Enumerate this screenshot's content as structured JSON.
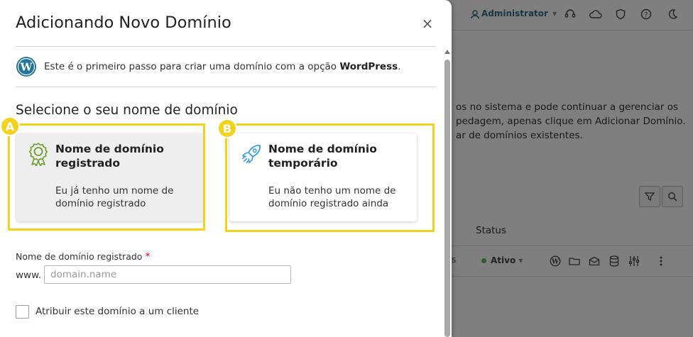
{
  "background": {
    "topbar": {
      "user_label": "Administrator",
      "chevron": "▾",
      "icons": [
        "support-icon",
        "cloud-icon",
        "shield-icon",
        "help-icon",
        "moon-icon"
      ]
    },
    "text_lines": [
      "os no sistema e pode continuar a gerenciar os",
      "pedagem, apenas clique em Adicionar Domínio.",
      "ar de domínios existentes."
    ],
    "toolbar_icons": [
      "filter-icon",
      "search-icon"
    ],
    "table": {
      "status_header": "Status",
      "row": {
        "pages_fragment": "s",
        "status": "Ativo",
        "icons": [
          "wordpress-icon",
          "folder-icon",
          "mail-icon",
          "database-icon",
          "settings-icon",
          "more-icon"
        ]
      }
    }
  },
  "drawer": {
    "title": "Adicionando Novo Domínio",
    "close_icon": "×",
    "info": {
      "text": "Este é o primeiro passo para criar uma domínio com a opção",
      "bold": "WordPress",
      "tail": "."
    },
    "section_title": "Selecione o seu nome de domínio",
    "cards": [
      {
        "id": "registered",
        "title": "Nome de domínio registrado",
        "description": "Eu já tenho um nome de domínio registrado",
        "icon": "award-icon",
        "selected": true,
        "badge": "A"
      },
      {
        "id": "temporary",
        "title": "Nome de domínio temporário",
        "description": "Eu não tenho um nome de domínio registrado ainda",
        "icon": "rocket-icon",
        "selected": false,
        "badge": "B"
      }
    ],
    "domain_field": {
      "label": "Nome de domínio registrado",
      "required_mark": "*",
      "prefix": "www.",
      "placeholder": "domain.name",
      "value": ""
    },
    "assign_client": {
      "label": "Atribuir este domínio a um cliente",
      "checked": false
    }
  },
  "colors": {
    "highlight": "#f2d21b",
    "link": "#2b6f8f",
    "award_icon": "#6a9e2a",
    "rocket_icon": "#2f9bd6",
    "required": "#d0021b"
  }
}
